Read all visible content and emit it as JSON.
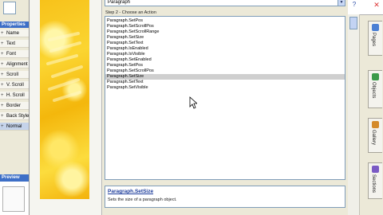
{
  "properties_panel": {
    "title": "Properties",
    "rows": [
      "Name",
      "Text",
      "Font",
      "Alignment",
      "Scroll",
      "V. Scroll",
      "H. Scroll",
      "Border",
      "Back Style",
      "Normal"
    ],
    "preview_title": "Preview"
  },
  "dialog": {
    "object_select_value": "Paragraph",
    "step_label": "Step 2 - Choose an Action",
    "actions": [
      {
        "label": "Paragraph.SetPos",
        "selected": false
      },
      {
        "label": "Paragraph.SetScrollPos",
        "selected": false
      },
      {
        "label": "Paragraph.SetScrollRange",
        "selected": false
      },
      {
        "label": "Paragraph.SetSize",
        "selected": false
      },
      {
        "label": "Paragraph.SetText",
        "selected": false
      },
      {
        "label": "Paragraph.IsEnabled",
        "selected": false
      },
      {
        "label": "Paragraph.IsVisible",
        "selected": false
      },
      {
        "label": "Paragraph.SetEnabled",
        "selected": false
      },
      {
        "label": "Paragraph.SetPos",
        "selected": false
      },
      {
        "label": "Paragraph.SetScrollPos",
        "selected": false
      },
      {
        "label": "Paragraph.SetSize",
        "selected": true
      },
      {
        "label": "Paragraph.SetText",
        "selected": false
      },
      {
        "label": "Paragraph.SetVisible",
        "selected": false
      }
    ],
    "info_title": "Paragraph.SetSize",
    "info_description": "Sets the size of a paragraph object."
  },
  "right_tabs": [
    "Pages",
    "Objects",
    "Gallery",
    "Sections"
  ],
  "colors": {
    "panel_title": "#3d6fc7",
    "selection": "#cfcfcf",
    "link": "#1a3a9a",
    "yellow_art": "#f7c21a"
  }
}
